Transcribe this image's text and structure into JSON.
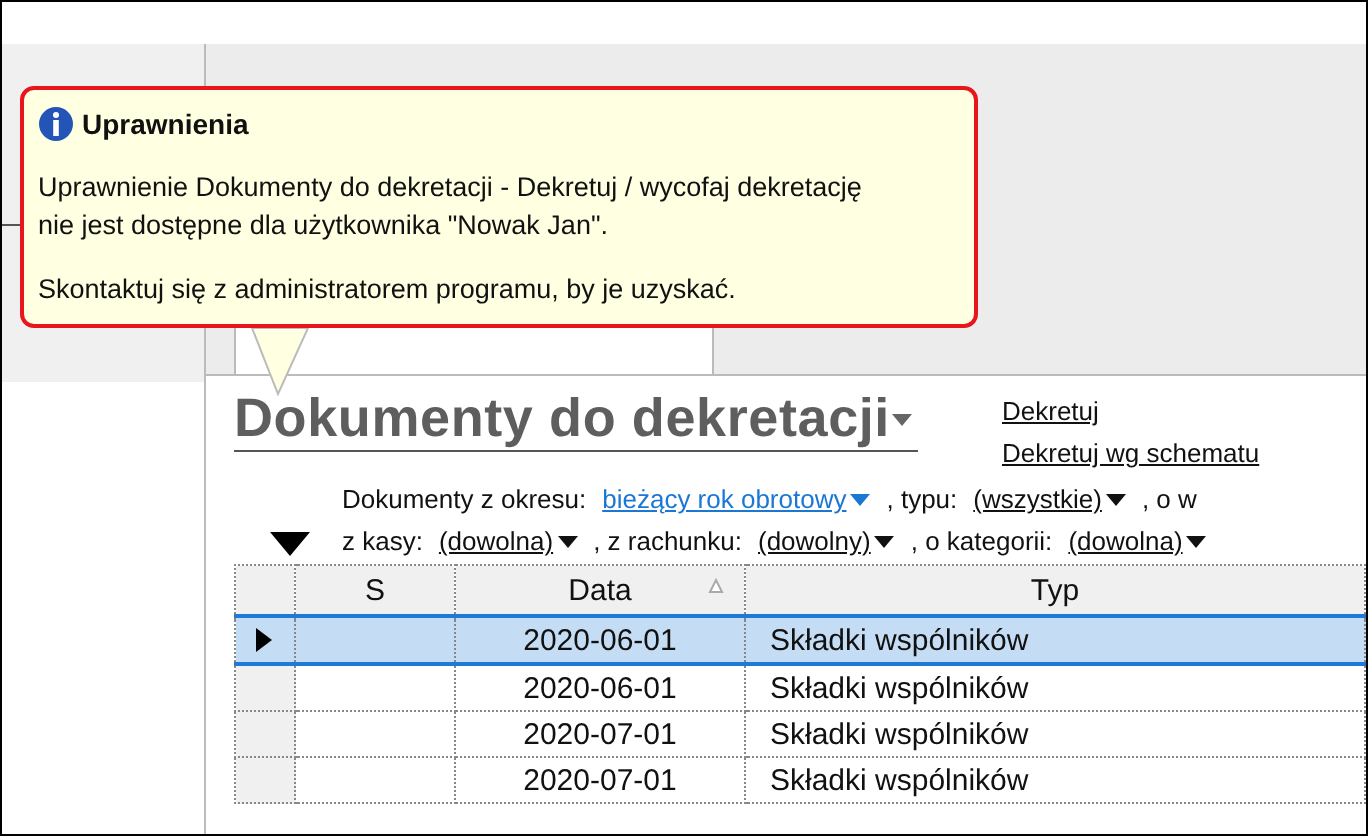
{
  "tooltip": {
    "title": "Uprawnienia",
    "paragraphs": [
      "Uprawnienie Dokumenty do dekretacji - Dekretuj / wycofaj dekretację\nnie jest dostępne dla użytkownika \"Nowak Jan\".",
      "Skontaktuj się z administratorem programu, by je uzyskać."
    ]
  },
  "page": {
    "title": "Dokumenty do dekretacji",
    "actions": [
      "Dekretuj",
      "Dekretuj wg schematu"
    ]
  },
  "filters": [
    [
      {
        "kind": "label",
        "text": "Dokumenty z okresu:"
      },
      {
        "kind": "link",
        "text": "bieżący rok obrotowy"
      },
      {
        "kind": "label",
        "text": ", typu:"
      },
      {
        "kind": "dropdown",
        "text": "(wszystkie)"
      },
      {
        "kind": "label",
        "text": ", o w"
      }
    ],
    [
      {
        "kind": "label",
        "text": "z kasy:"
      },
      {
        "kind": "dropdown",
        "text": "(dowolna)"
      },
      {
        "kind": "label",
        "text": ", z rachunku:"
      },
      {
        "kind": "dropdown",
        "text": "(dowolny)"
      },
      {
        "kind": "label",
        "text": ", o kategorii:"
      },
      {
        "kind": "dropdown",
        "text": "(dowolna)"
      }
    ]
  ],
  "table": {
    "columns": [
      {
        "label": "S",
        "sorted": false
      },
      {
        "label": "Data",
        "sorted": true
      },
      {
        "label": "Typ",
        "sorted": false
      }
    ],
    "rows": [
      {
        "selected": true,
        "cells": [
          "",
          "2020-06-01",
          "Składki wspólników"
        ]
      },
      {
        "selected": false,
        "cells": [
          "",
          "2020-06-01",
          "Składki wspólników"
        ]
      },
      {
        "selected": false,
        "cells": [
          "",
          "2020-07-01",
          "Składki wspólników"
        ]
      },
      {
        "selected": false,
        "cells": [
          "",
          "2020-07-01",
          "Składki wspólników"
        ]
      }
    ]
  }
}
